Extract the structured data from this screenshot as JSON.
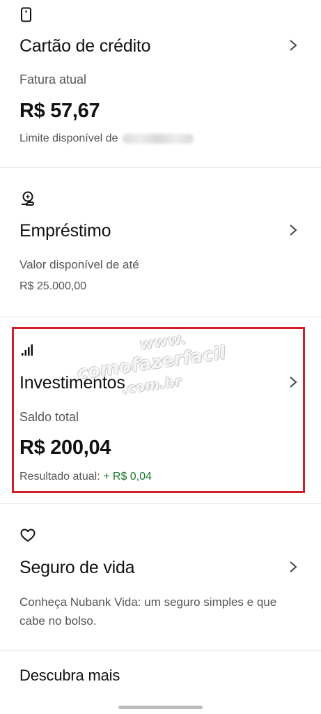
{
  "credit_card": {
    "title": "Cartão de crédito",
    "label": "Fatura atual",
    "amount": "R$ 57,67",
    "limit_label": "Limite disponível de"
  },
  "loan": {
    "title": "Empréstimo",
    "label": "Valor disponível de até",
    "amount": "R$ 25.000,00"
  },
  "investments": {
    "title": "Investimentos",
    "label": "Saldo total",
    "amount": "R$ 200,04",
    "result_label": "Resultado atual:",
    "result_value": "+ R$ 0,04"
  },
  "insurance": {
    "title": "Seguro de vida",
    "description_line1": "Conheça Nubank Vida: um seguro simples e que",
    "description_line2": "cabe no bolso."
  },
  "discover": {
    "title": "Descubra mais"
  },
  "watermark": {
    "line1": "www.",
    "line2": "comofazerfacil",
    "line3": ".com.br"
  },
  "colors": {
    "highlight": "#d01f2a",
    "positive": "#1b7a2e"
  },
  "icons": {
    "credit_card": "card-icon",
    "loan": "loan-hand-icon",
    "investments": "signal-bars-icon",
    "insurance": "heart-icon",
    "chevron": "chevron-right-icon"
  }
}
